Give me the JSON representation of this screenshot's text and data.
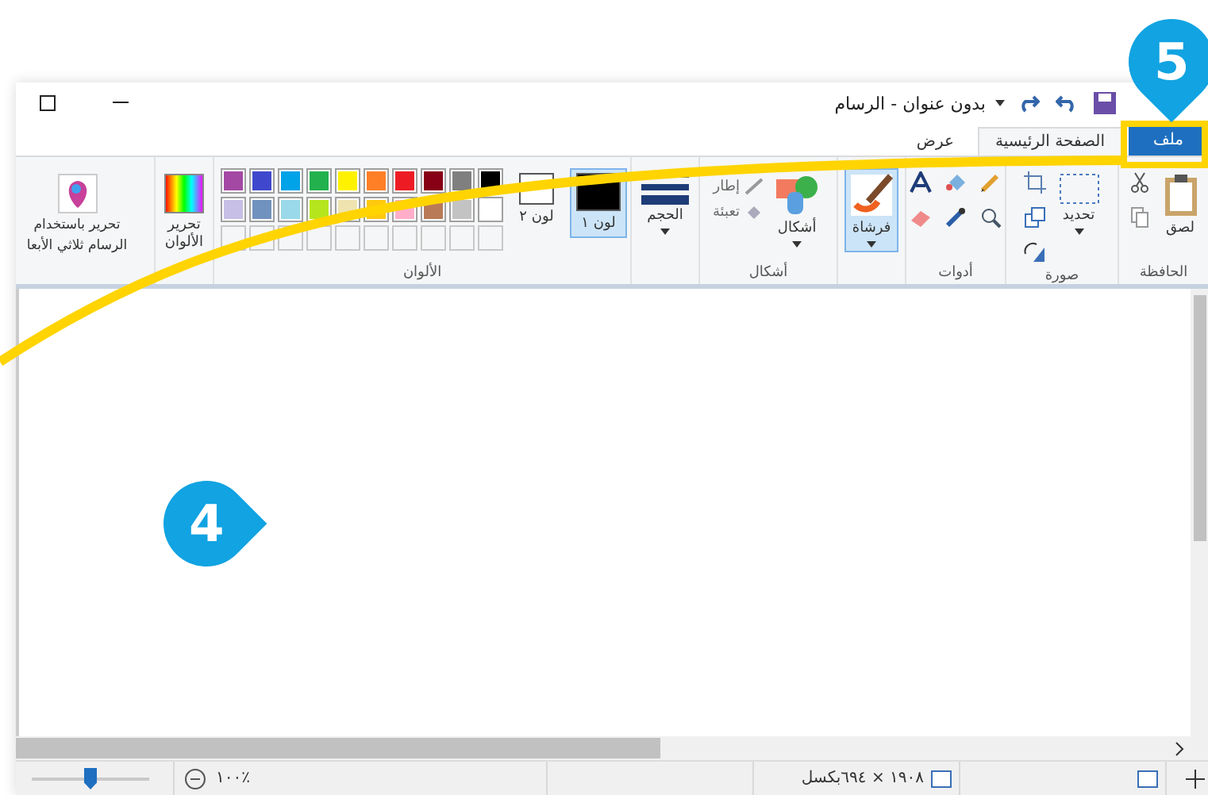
{
  "title_bar": {
    "title": "بدون عنوان - الرسام"
  },
  "file_tab": {
    "label": "ملف"
  },
  "tabs": [
    {
      "label": "الصفحة الرئيسية",
      "selected": true
    },
    {
      "label": "عرض",
      "selected": false
    }
  ],
  "clipboard": {
    "label": "الحافظة",
    "paste": "لصق"
  },
  "image": {
    "label": "صورة",
    "select": "تحديد"
  },
  "tools": {
    "label": "أدوات"
  },
  "brushes": {
    "label": "فرشاة",
    "selected": true
  },
  "shapes": {
    "label": "أشكال",
    "shapes_button": "أشكال",
    "outline": "إطار",
    "fill": "تعبئة"
  },
  "size": {
    "label": "الحجم"
  },
  "colors": {
    "label": "الألوان",
    "edit_colors": "تحرير الألوان",
    "color1": {
      "label": "لون ١",
      "selected": true,
      "color": "#000000"
    },
    "color2": {
      "label": "لون ٢",
      "selected": false,
      "color": "#ffffff"
    },
    "palette": [
      {
        "color": "#000000"
      },
      {
        "color": "#7f7f7f"
      },
      {
        "color": "#880015"
      },
      {
        "color": "#ed1c24"
      },
      {
        "color": "#ff7f27"
      },
      {
        "color": "#fff200"
      },
      {
        "color": "#22b14c"
      },
      {
        "color": "#00a2e8"
      },
      {
        "color": "#3f48cc"
      },
      {
        "color": "#a349a4"
      },
      {
        "color": "#ffffff"
      },
      {
        "color": "#c3c3c3"
      },
      {
        "color": "#b97a57"
      },
      {
        "color": "#ffaec9"
      },
      {
        "color": "#ffc90e"
      },
      {
        "color": "#efe4b0"
      },
      {
        "color": "#b5e61d"
      },
      {
        "color": "#99d9ea"
      },
      {
        "color": "#7092be"
      },
      {
        "color": "#c8bfe7"
      }
    ]
  },
  "paint3d": {
    "lines": [
      "تحرير باستخدام",
      "الرسام ثلاثي الأبعا"
    ]
  },
  "status_bar": {
    "dimensions": "١٩٠٨ × ٦٩٤بكسل",
    "zoom": "١٠٠٪",
    "zoom_slider": {
      "level": 0.5
    }
  },
  "callouts": [
    {
      "label": "5"
    },
    {
      "label": "4"
    }
  ]
}
